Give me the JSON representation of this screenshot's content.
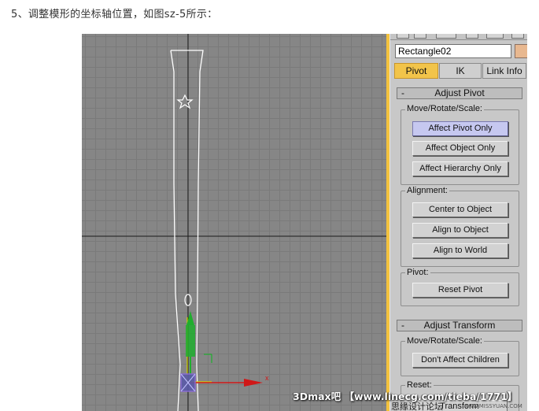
{
  "caption": "5、调整模形的坐标轴位置，如图sz-5所示：",
  "viewport": {
    "axis_x_label": "x"
  },
  "panel": {
    "object_name": "Rectangle02",
    "tabs": [
      "Pivot",
      "IK",
      "Link Info"
    ],
    "adjust_pivot": {
      "title": "Adjust Pivot",
      "collapse": "-",
      "move_group": {
        "label": "Move/Rotate/Scale:",
        "buttons": [
          "Affect Pivot Only",
          "Affect Object Only",
          "Affect Hierarchy Only"
        ]
      },
      "alignment_group": {
        "label": "Alignment:",
        "buttons": [
          "Center to Object",
          "Align to Object",
          "Align to World"
        ]
      },
      "pivot_group": {
        "label": "Pivot:",
        "buttons": [
          "Reset Pivot"
        ]
      }
    },
    "adjust_transform": {
      "title": "Adjust Transform",
      "collapse": "-",
      "move_group": {
        "label": "Move/Rotate/Scale:",
        "buttons": [
          "Don't Affect Children"
        ]
      },
      "reset_group": {
        "label": "Reset:",
        "buttons": [
          "Transform"
        ]
      }
    }
  },
  "watermark": {
    "main": "3Dmax吧 【www.linecg.com/tieba/1771】",
    "sub": "思缘设计论坛",
    "site": "www.MISSYUAN.COM"
  },
  "colors": {
    "accent": "#f2c44a",
    "viewport_bg": "#868686",
    "pressed_button": "#c6c8f0",
    "axis_y": "#1fae2e",
    "axis_x": "#d01818"
  }
}
